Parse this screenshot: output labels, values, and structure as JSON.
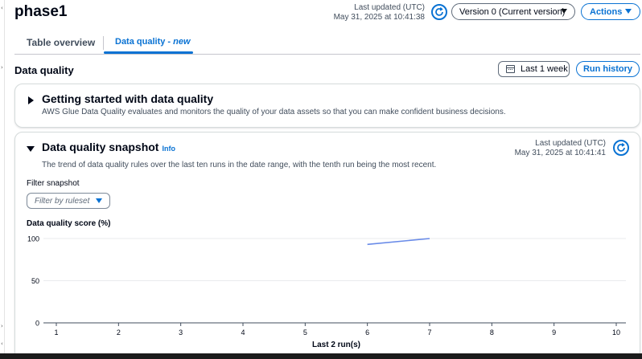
{
  "header": {
    "title": "phase1",
    "last_updated_label": "Last updated (UTC)",
    "last_updated_value": "May 31, 2025 at 10:41:38",
    "version_select": "Version 0 (Current version)",
    "actions_label": "Actions"
  },
  "tabs": [
    {
      "label": "Table overview"
    },
    {
      "label": "Data quality - ",
      "tag": "new",
      "selected": true
    }
  ],
  "section": {
    "title": "Data quality",
    "range_label": "Last 1 week",
    "run_history_label": "Run history"
  },
  "getting_started": {
    "heading": "Getting started with data quality",
    "description": "AWS Glue Data Quality evaluates and monitors the quality of your data assets so that you can make confident business decisions."
  },
  "snapshot": {
    "heading": "Data quality snapshot",
    "info_link": "Info",
    "description": "The trend of data quality rules over the last ten runs in the date range, with the tenth run being the most recent.",
    "last_updated_label": "Last updated (UTC)",
    "last_updated_value": "May 31, 2025 at 10:41:41",
    "filter_label": "Filter snapshot",
    "filter_placeholder": "Filter by ruleset",
    "chart_label": "Data quality score (%)"
  },
  "chart_data": {
    "type": "line",
    "title": "",
    "ylabel": "Data quality score (%)",
    "xlabel": "Last 2 run(s)",
    "x_ticks": [
      1,
      2,
      3,
      4,
      5,
      6,
      7,
      8,
      9,
      10
    ],
    "y_ticks": [
      0,
      50,
      100
    ],
    "xlim": [
      1,
      10
    ],
    "ylim": [
      0,
      100
    ],
    "grid": true,
    "series": [
      {
        "x": [
          6,
          7
        ],
        "values": [
          93,
          100
        ],
        "color": "#688ae8"
      }
    ]
  },
  "edge_marks": [
    "‹",
    "›",
    "›",
    "‹"
  ],
  "colors": {
    "accent": "#0972d3",
    "text": "#000716",
    "muted": "#414d5c",
    "line": "#688ae8"
  }
}
